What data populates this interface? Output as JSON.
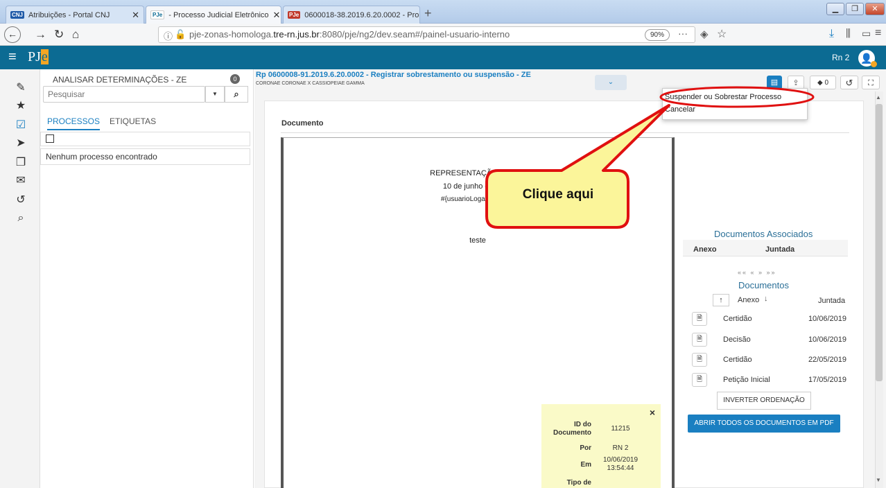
{
  "browser": {
    "tabs": [
      {
        "label": "Atribuições - Portal CNJ",
        "favicon": "CNJ"
      },
      {
        "label": " - Processo Judicial Eletrônico",
        "favicon": "PJe"
      },
      {
        "label": "0600018-38.2019.6.20.0002 - Pro",
        "favicon": "PJe"
      }
    ],
    "new_tab": "+",
    "url_plain_start": "pje-zonas-homologa.",
    "url_bold": "tre-rn.jus.br",
    "url_plain_end": ":8080/pje/ng2/dev.seam#/painel-usuario-interno",
    "zoom": "90%",
    "url_more": "···"
  },
  "app": {
    "logo_a": "PJ",
    "logo_b": "e",
    "user_label": "Rn 2"
  },
  "panel": {
    "title": "ANALISAR DETERMINAÇÕES - ZE",
    "count": "0",
    "search_placeholder": "Pesquisar",
    "tab_processos": "PROCESSOS",
    "tab_etiquetas": "ETIQUETAS",
    "empty_message": "Nenhum processo encontrado"
  },
  "process": {
    "title": "Rp 0600008-91.2019.6.20.0002 - Registrar sobrestamento ou suspensão - ZE",
    "parties": "CORONAE CORONAE X CASSIOPEIAE GAMMA",
    "tag_count": "0"
  },
  "menu": {
    "item1": "Suspender ou Sobrestar Processo",
    "item2": "Cancelar"
  },
  "callout": {
    "text": "Clique aqui"
  },
  "document": {
    "heading": "Documento",
    "line1": "REPRESENTAÇÃO (11541)",
    "line2": "10 de junho de 2019",
    "line3": "#{usuarioLogado.nome}",
    "body": "teste"
  },
  "info_box": {
    "close": "×",
    "id_label": "ID do Documento",
    "id_value": "11215",
    "por_label": "Por",
    "por_value": "RN 2",
    "em_label": "Em",
    "em_value": "10/06/2019 13:54:44",
    "tipo_label": "Tipo de"
  },
  "associated": {
    "title": "Documentos Associados",
    "col_anexo": "Anexo",
    "col_juntada": "Juntada",
    "pager": "«« « » »»"
  },
  "documents": {
    "title": "Documentos",
    "col_anexo": "Anexo",
    "col_juntada": "Juntada",
    "rows": [
      {
        "name": "Certidão",
        "date": "10/06/2019"
      },
      {
        "name": "Decisão",
        "date": "10/06/2019"
      },
      {
        "name": "Certidão",
        "date": "22/05/2019"
      },
      {
        "name": "Petição Inicial",
        "date": "17/05/2019"
      }
    ],
    "invert_button": "INVERTER ORDENAÇÃO",
    "open_all_button": "ABRIR TODOS OS DOCUMENTOS EM PDF"
  },
  "colors": {
    "appbar": "#0c6b93",
    "accent": "#1a7fc1",
    "callout_fill": "#fbf59a",
    "callout_border": "#e01010"
  }
}
